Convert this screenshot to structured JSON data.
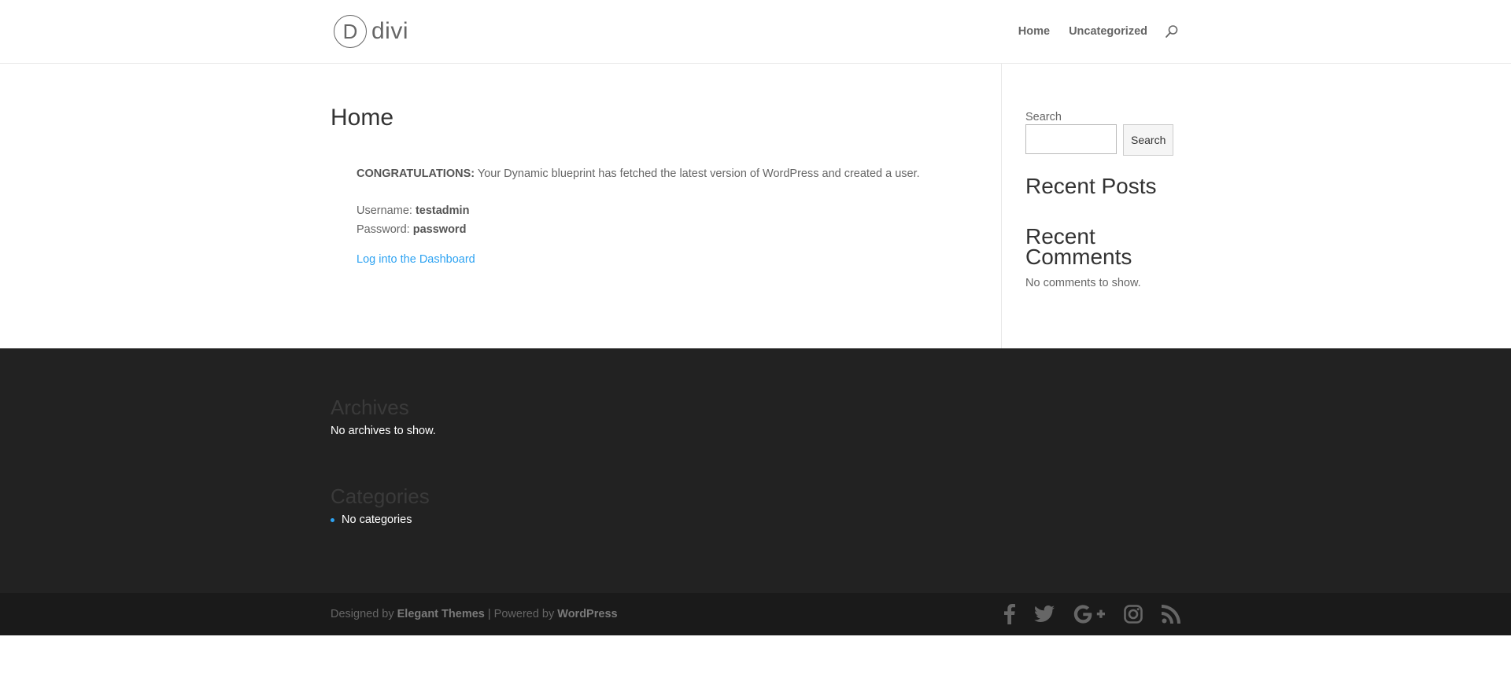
{
  "header": {
    "logo_letter": "D",
    "logo_text": "divi",
    "nav": [
      {
        "label": "Home"
      },
      {
        "label": "Uncategorized"
      }
    ]
  },
  "main": {
    "title": "Home",
    "congrats_label": "CONGRATULATIONS:",
    "congrats_text": " Your Dynamic blueprint has fetched the latest version of WordPress and created a user.",
    "username_label": "Username: ",
    "username_value": "testadmin",
    "password_label": "Password: ",
    "password_value": "password",
    "dashboard_link": "Log into the Dashboard"
  },
  "sidebar": {
    "search_label": "Search",
    "search_value": "",
    "search_button": "Search",
    "recent_posts_title": "Recent Posts",
    "recent_comments_title": "Recent Comments",
    "no_comments": "No comments to show."
  },
  "footer": {
    "archives_title": "Archives",
    "no_archives": "No archives to show.",
    "categories_title": "Categories",
    "no_categories": "No categories",
    "credits_prefix": "Designed by ",
    "credits_theme": "Elegant Themes",
    "credits_middle": " | Powered by ",
    "credits_wp": "WordPress",
    "social_icons": [
      "facebook-icon",
      "twitter-icon",
      "google-plus-icon",
      "instagram-icon",
      "rss-icon"
    ]
  },
  "colors": {
    "link": "#2ea3f2",
    "footer_bg": "#222222",
    "bottom_bar_bg": "#1a1a1a"
  }
}
